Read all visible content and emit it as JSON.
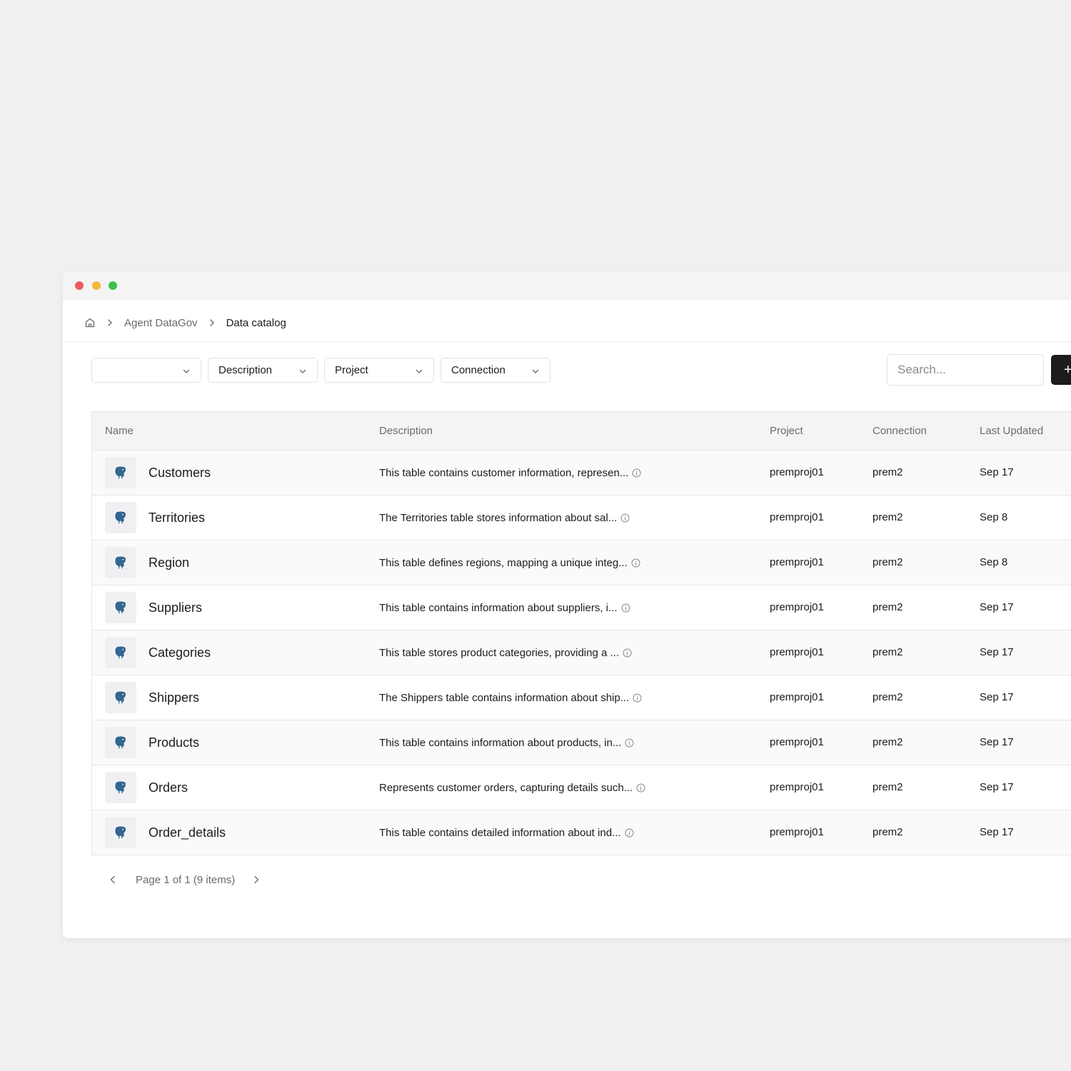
{
  "breadcrumb": {
    "home_icon": "home-icon",
    "parent": "Agent DataGov",
    "current": "Data catalog"
  },
  "filters": {
    "first": "",
    "description": "Description",
    "project": "Project",
    "connection": "Connection"
  },
  "search": {
    "placeholder": "Search..."
  },
  "toolbar": {
    "add_label": "+"
  },
  "table": {
    "columns": [
      "Name",
      "Description",
      "Project",
      "Connection",
      "Last Updated"
    ],
    "row_icon": "postgresql-elephant-icon",
    "rows": [
      {
        "name": "Customers",
        "description": "This table contains customer information, represen...",
        "project": "premproj01",
        "connection": "prem2",
        "updated": "Sep 17"
      },
      {
        "name": "Territories",
        "description": "The Territories table stores information about sal...",
        "project": "premproj01",
        "connection": "prem2",
        "updated": "Sep 8"
      },
      {
        "name": "Region",
        "description": "This table defines regions, mapping a unique integ...",
        "project": "premproj01",
        "connection": "prem2",
        "updated": "Sep 8"
      },
      {
        "name": "Suppliers",
        "description": "This table contains information about suppliers, i...",
        "project": "premproj01",
        "connection": "prem2",
        "updated": "Sep 17"
      },
      {
        "name": "Categories",
        "description": "This table stores product categories, providing a ...",
        "project": "premproj01",
        "connection": "prem2",
        "updated": "Sep 17"
      },
      {
        "name": "Shippers",
        "description": "The Shippers table contains information about ship...",
        "project": "premproj01",
        "connection": "prem2",
        "updated": "Sep 17"
      },
      {
        "name": "Products",
        "description": "This table contains information about products, in...",
        "project": "premproj01",
        "connection": "prem2",
        "updated": "Sep 17"
      },
      {
        "name": "Orders",
        "description": "Represents customer orders, capturing details such...",
        "project": "premproj01",
        "connection": "prem2",
        "updated": "Sep 17"
      },
      {
        "name": "Order_details",
        "description": "This table contains detailed information about ind...",
        "project": "premproj01",
        "connection": "prem2",
        "updated": "Sep 17"
      }
    ]
  },
  "pagination": {
    "text": "Page 1 of 1 (9 items)"
  },
  "colors": {
    "accent": "#1c1c1e",
    "db_icon": "#336791"
  }
}
